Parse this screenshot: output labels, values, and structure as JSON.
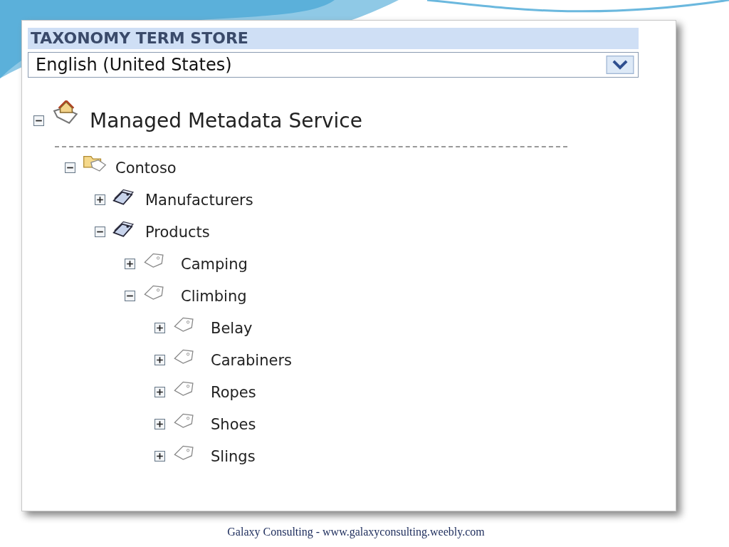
{
  "panel": {
    "title": "TAXONOMY TERM STORE",
    "language": {
      "value": "English (United States)"
    }
  },
  "tree": [
    {
      "kind": "service",
      "label": "Managed Metadata Service",
      "expanded": true,
      "children": [
        {
          "kind": "group",
          "label": "Contoso",
          "expanded": true,
          "children": [
            {
              "kind": "termset",
              "label": "Manufacturers",
              "expanded": false
            },
            {
              "kind": "termset",
              "label": "Products",
              "expanded": true,
              "children": [
                {
                  "kind": "term",
                  "label": "Camping",
                  "expanded": false
                },
                {
                  "kind": "term",
                  "label": "Climbing",
                  "expanded": true,
                  "children": [
                    {
                      "kind": "term",
                      "label": "Belay",
                      "expanded": false
                    },
                    {
                      "kind": "term",
                      "label": "Carabiners",
                      "expanded": false
                    },
                    {
                      "kind": "term",
                      "label": "Ropes",
                      "expanded": false
                    },
                    {
                      "kind": "term",
                      "label": "Shoes",
                      "expanded": false
                    },
                    {
                      "kind": "term",
                      "label": "Slings",
                      "expanded": false
                    }
                  ]
                }
              ]
            }
          ]
        }
      ]
    }
  ],
  "footer": "Galaxy Consulting - www.galaxyconsulting.weebly.com"
}
